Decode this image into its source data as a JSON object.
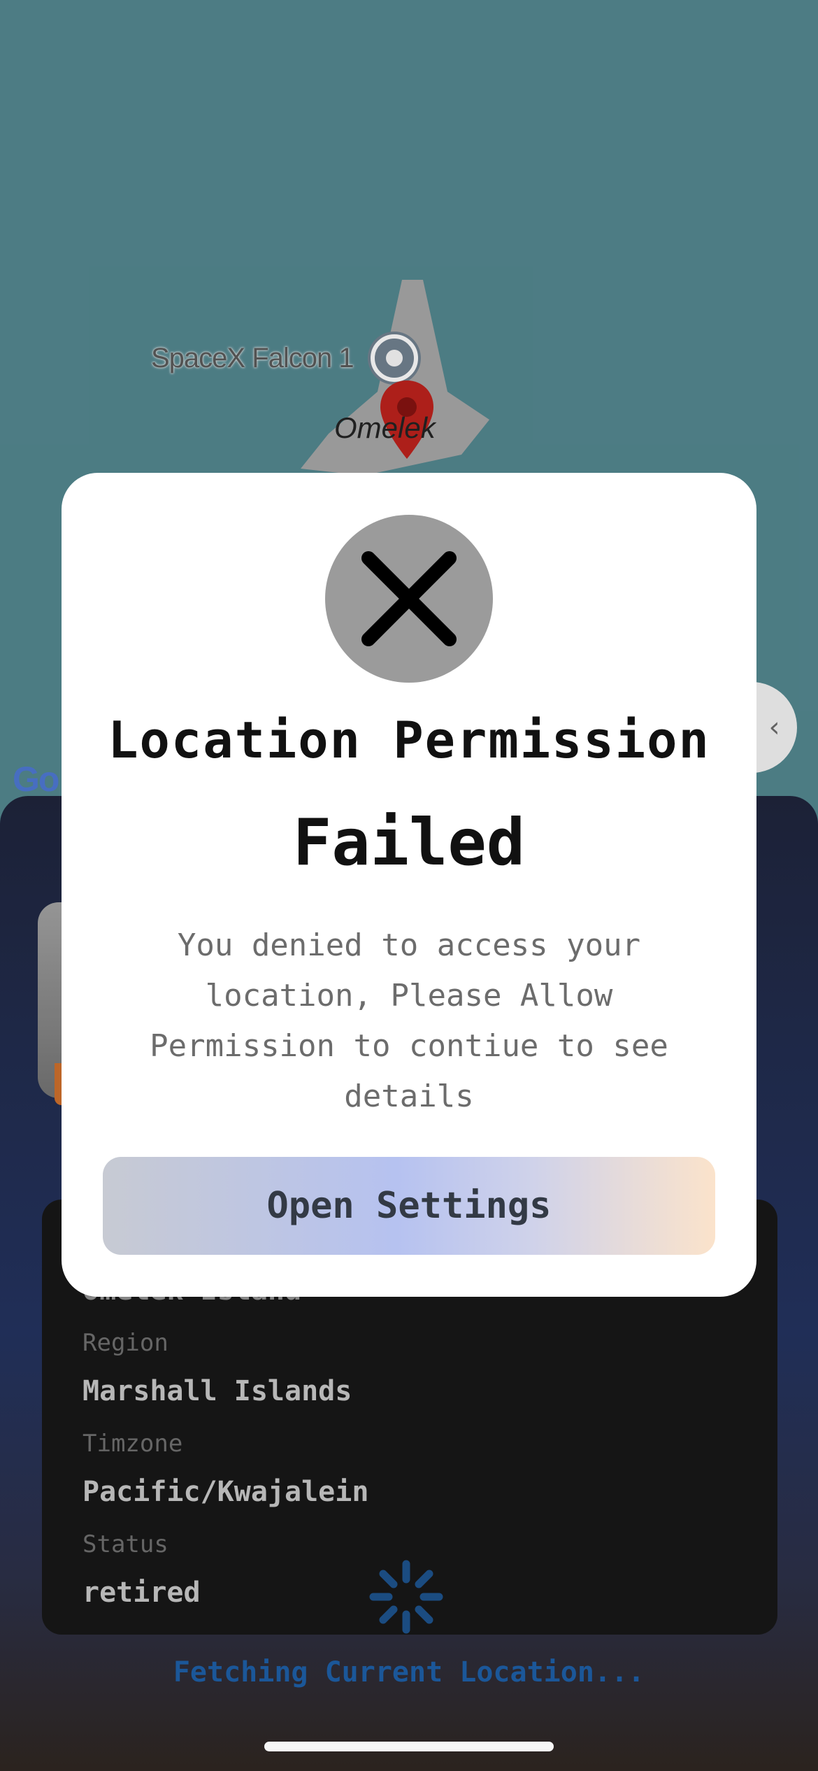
{
  "map": {
    "poi_label": "SpaceX Falcon 1",
    "island_label": "Omelek",
    "google_logo": "Go",
    "fab_icon": "chevron-icon"
  },
  "details": {
    "partial_value": "Omelek Island",
    "region_label": "Region",
    "region_value": "Marshall Islands",
    "timezone_label": "Timzone",
    "timezone_value": "Pacific/Kwajalein",
    "status_label": "Status",
    "status_value": "retired"
  },
  "fetching_text": "Fetching Current Location...",
  "dialog": {
    "icon": "close-icon",
    "title_line1": "Location Permission",
    "title_line2": "Failed",
    "message": "You denied to access your location, Please Allow Permission to contiue to see details",
    "button_label": "Open Settings"
  },
  "colors": {
    "map_water": "#4f8088",
    "sheet_top": "#1d2338",
    "accent_text": "#1c5a9e",
    "error_circle": "#9b9b9b"
  }
}
